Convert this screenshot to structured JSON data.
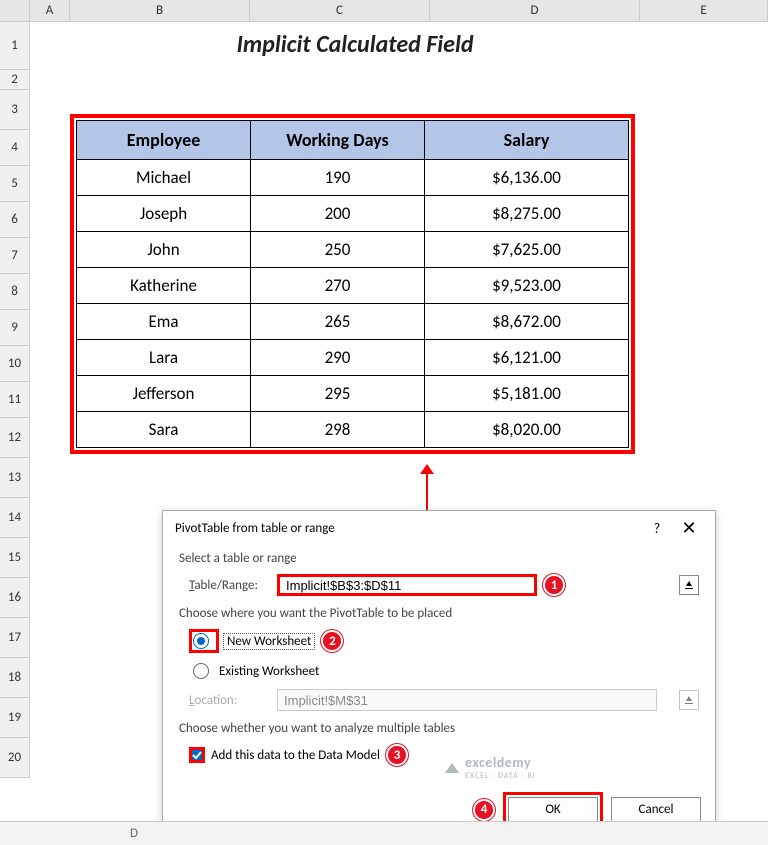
{
  "columns": [
    "A",
    "B",
    "C",
    "D",
    "E"
  ],
  "rows": [
    "1",
    "2",
    "3",
    "4",
    "5",
    "6",
    "7",
    "8",
    "9",
    "10",
    "11",
    "12",
    "13",
    "14",
    "15",
    "16",
    "17",
    "18",
    "19",
    "20"
  ],
  "title": "Implicit Calculated Field",
  "table": {
    "headers": [
      "Employee",
      "Working Days",
      "Salary"
    ],
    "rows": [
      [
        "Michael",
        "190",
        "$6,136.00"
      ],
      [
        "Joseph",
        "200",
        "$8,275.00"
      ],
      [
        "John",
        "250",
        "$7,625.00"
      ],
      [
        "Katherine",
        "270",
        "$9,523.00"
      ],
      [
        "Ema",
        "265",
        "$8,672.00"
      ],
      [
        "Lara",
        "290",
        "$6,121.00"
      ],
      [
        "Jefferson",
        "295",
        "$5,181.00"
      ],
      [
        "Sara",
        "298",
        "$8,020.00"
      ]
    ]
  },
  "dialog": {
    "title": "PivotTable from table or range",
    "help": "?",
    "close": "✕",
    "section1": "Select a table or range",
    "table_range_label_pre": "T",
    "table_range_label_post": "able/Range:",
    "table_range_value": "Implicit!$B$3:$D$11",
    "section2": "Choose where you want the PivotTable to be placed",
    "radio_new_pre": "N",
    "radio_new_post": "ew Worksheet",
    "radio_existing_pre": "E",
    "radio_existing_post": "xisting Worksheet",
    "location_label_pre": "L",
    "location_label_post": "ocation:",
    "location_value": "Implicit!$M$31",
    "section3": "Choose whether you want to analyze multiple tables",
    "check_label_pre": "Add this data to the Data ",
    "check_label_mid": "M",
    "check_label_post": "odel",
    "ok": "OK",
    "cancel": "Cancel"
  },
  "badges": {
    "b1": "1",
    "b2": "2",
    "b3": "3",
    "b4": "4"
  },
  "watermark": {
    "main": "exceldemy",
    "sub": "EXCEL · DATA · BI"
  },
  "tab": "D"
}
